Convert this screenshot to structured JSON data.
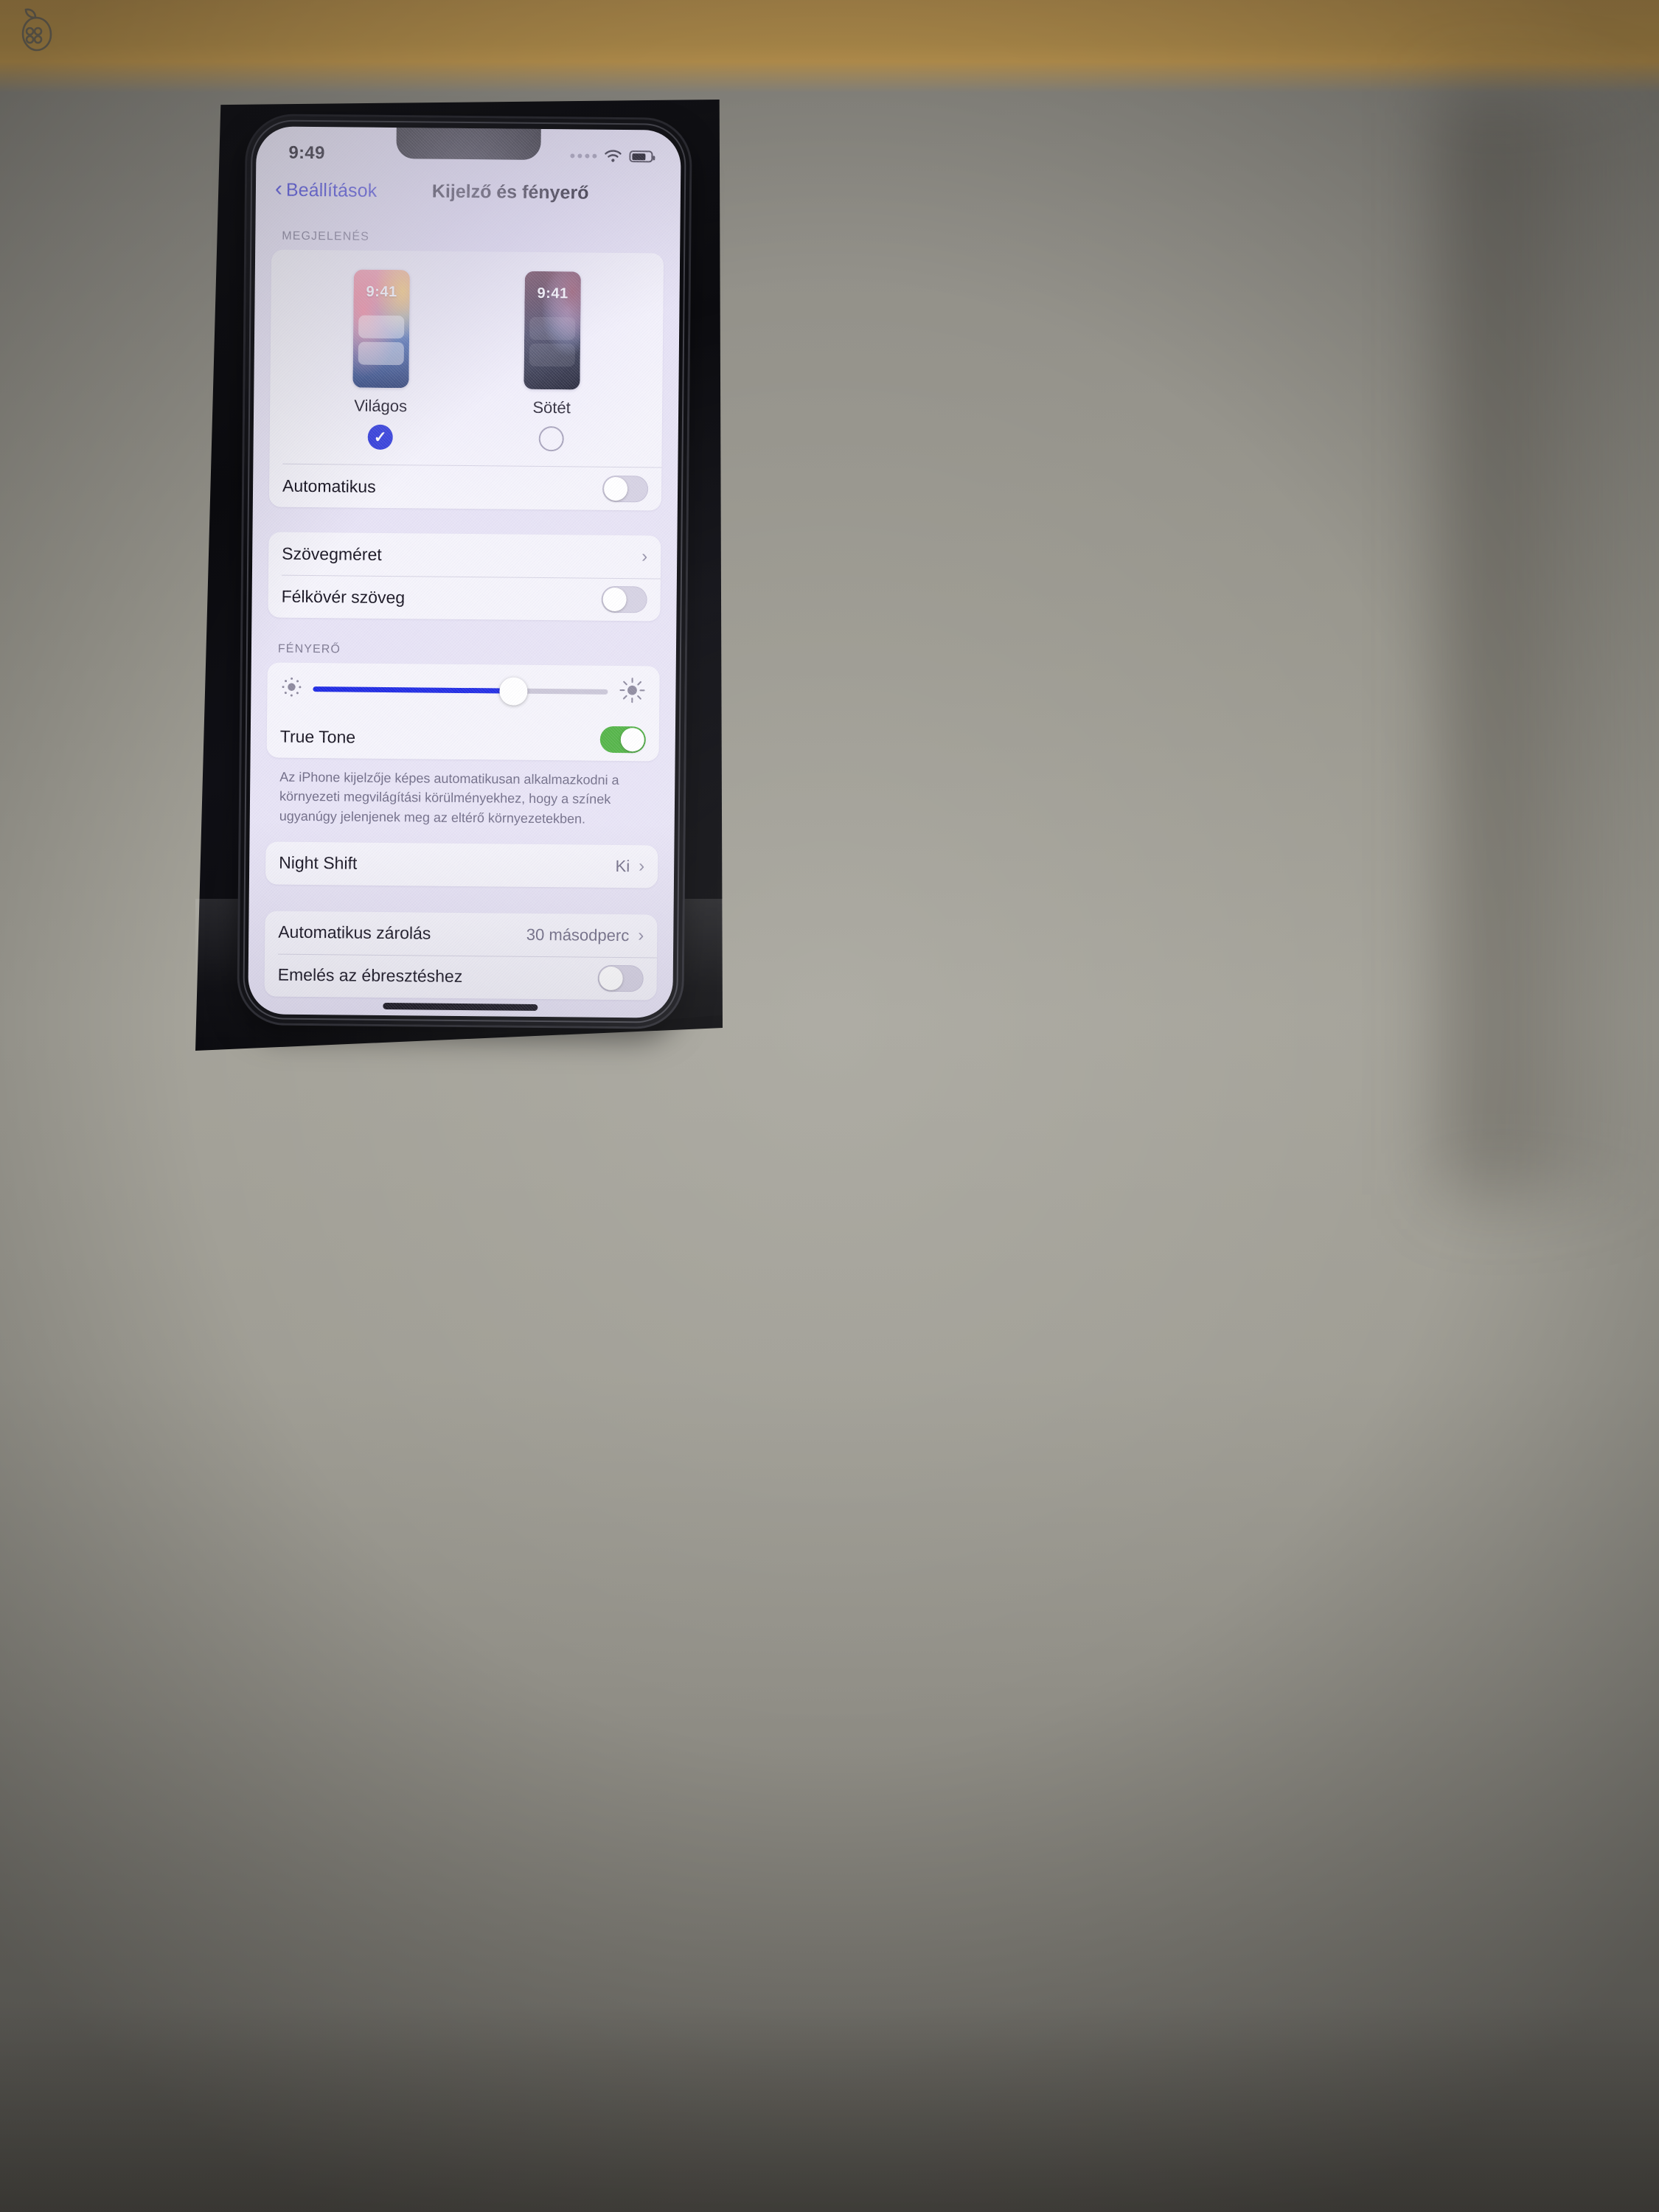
{
  "photo": {
    "watermark_icon": "apple-command-logo-watermark",
    "surface": "desk with phone box"
  },
  "status_bar": {
    "time": "9:49",
    "signal_icon": "signal-dots-icon",
    "wifi_icon": "wifi-icon",
    "battery_icon": "battery-icon",
    "battery_level_pct": 74
  },
  "nav": {
    "back_icon": "chevron-left-icon",
    "back_label": "Beállítások",
    "title": "Kijelző és fényerő"
  },
  "appearance": {
    "header": "MEGJELENÉS",
    "options": [
      {
        "label": "Világos",
        "preview_clock": "9:41",
        "selected": true,
        "radio_icon": "check-circle-icon"
      },
      {
        "label": "Sötét",
        "preview_clock": "9:41",
        "selected": false,
        "radio_icon": "circle-icon"
      }
    ],
    "auto_row": {
      "label": "Automatikus",
      "toggle": "off"
    }
  },
  "text_section": {
    "rows": [
      {
        "label": "Szövegméret",
        "type": "disclosure",
        "chevron": "›"
      },
      {
        "label": "Félkövér szöveg",
        "type": "toggle",
        "toggle": "off"
      }
    ]
  },
  "brightness": {
    "header": "FÉNYERŐ",
    "slider": {
      "value_pct": 68,
      "low_icon": "sun-small-icon",
      "high_icon": "sun-large-icon"
    },
    "true_tone": {
      "label": "True Tone",
      "toggle": "on",
      "toggle_color": "#4cb13f"
    },
    "footnote": "Az iPhone kijelzője képes automatikusan alkalmazkodni a környezeti megvilágítási körülményekhez, hogy a színek ugyanúgy jelenjenek meg az eltérő környezetekben."
  },
  "night_shift": {
    "label": "Night Shift",
    "value": "Ki",
    "chevron": "›"
  },
  "lock_section": {
    "rows": [
      {
        "label": "Automatikus zárolás",
        "value": "30 másodperc",
        "chevron": "›",
        "type": "disclosure"
      },
      {
        "label": "Emelés az ébresztéshez",
        "type": "toggle",
        "toggle": "off"
      }
    ]
  },
  "colors": {
    "accent_blue": "#3b3bd8",
    "slider_blue": "#1a26e3",
    "toggle_green": "#4cb13f",
    "screen_bg": "#e7e3f5"
  }
}
